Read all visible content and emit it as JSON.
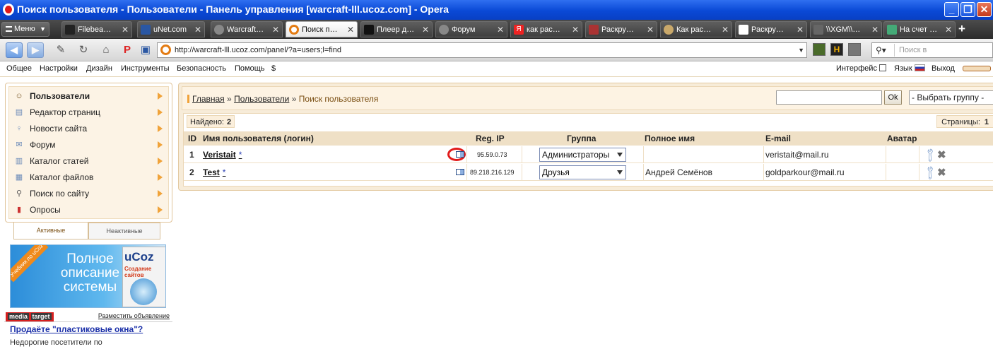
{
  "window": {
    "title": "Поиск пользователя - Пользователи - Панель управления [warcraft-lll.ucoz.com] - Opera",
    "minimize": "_",
    "restore": "❐",
    "close": "✕"
  },
  "tabbar": {
    "menu_label": "Меню",
    "tabs": [
      {
        "label": "Filebea…"
      },
      {
        "label": "uNet.com"
      },
      {
        "label": "Warcraft…"
      },
      {
        "label": "Поиск п…"
      },
      {
        "label": "Плеер д…"
      },
      {
        "label": "Форум"
      },
      {
        "label": "как рас…"
      },
      {
        "label": "Раскру…"
      },
      {
        "label": "Как рас…"
      },
      {
        "label": "Раскру…"
      },
      {
        "label": "\\\\XGM\\\\…"
      },
      {
        "label": "На счет …"
      }
    ],
    "close_glyph": "✕",
    "new_tab": "+"
  },
  "addressbar": {
    "url": "http://warcraft-lll.ucoz.com/panel/?a=users;l=find",
    "search_placeholder": "Поиск в"
  },
  "cp_menu": {
    "items": [
      "Общее",
      "Настройки",
      "Дизайн",
      "Инструменты",
      "Безопасность",
      "Помощь",
      "$"
    ],
    "interface_label": "Интерфейс",
    "language_label": "Язык",
    "exit_label": "Выход"
  },
  "sidebar": {
    "items": [
      {
        "label": "Пользователи",
        "icon": "user-icon"
      },
      {
        "label": "Редактор страниц",
        "icon": "page-icon"
      },
      {
        "label": "Новости сайта",
        "icon": "lightbulb-icon"
      },
      {
        "label": "Форум",
        "icon": "forum-icon"
      },
      {
        "label": "Каталог статей",
        "icon": "articles-icon"
      },
      {
        "label": "Каталог файлов",
        "icon": "files-icon"
      },
      {
        "label": "Поиск по сайту",
        "icon": "search-icon"
      },
      {
        "label": "Опросы",
        "icon": "poll-icon"
      }
    ],
    "tab_active": "Активные",
    "tab_inactive": "Неактивные"
  },
  "banner": {
    "ribbon": "Учебник по uCoz",
    "heading": "Полное описание системы",
    "book_title": "uCoz",
    "book_subtitle": "Создание сайтов"
  },
  "mediatarget": {
    "logo_media": "media",
    "logo_target": "target",
    "place_ad": "Разместить объявление",
    "headline": "Продаёте \"пластиковые окна\"?",
    "text": "Недорогие посетители по"
  },
  "breadcrumb": {
    "home": "Главная",
    "users": "Пользователи",
    "current": "Поиск пользователя",
    "sep": "»"
  },
  "finder": {
    "ok_label": "Ok",
    "group_select": "- Выбрать группу -"
  },
  "list": {
    "found_label": "Найдено:",
    "found_count": "2",
    "pages_label": "Страницы:",
    "page": "1",
    "columns": {
      "id": "ID",
      "login": "Имя пользователя (логин)",
      "ip": "Reg. IP",
      "group": "Группа",
      "fullname": "Полное имя",
      "email": "E-mail",
      "avatar": "Аватар"
    },
    "rows": [
      {
        "id": "1",
        "login": "Veristait",
        "star": "*",
        "ip": "95.59.0.73",
        "group": "Администраторы",
        "fullname": "",
        "email": "veristait@mail.ru"
      },
      {
        "id": "2",
        "login": "Test",
        "star": "*",
        "ip": "89.218.216.129",
        "group": "Друзья",
        "fullname": "Андрей Семёнов",
        "email": "goldparkour@mail.ru"
      }
    ]
  }
}
